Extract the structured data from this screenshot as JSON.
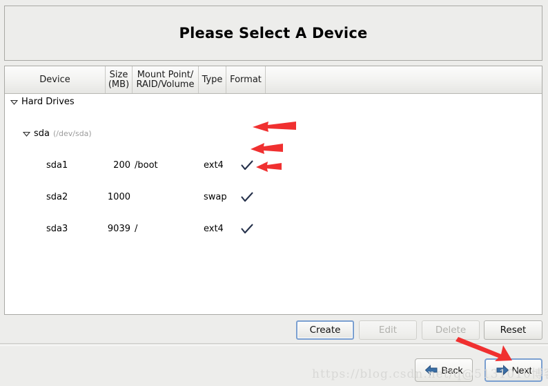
{
  "window": {
    "title": "Please Select A Device"
  },
  "colors": {
    "background": "#ededeb",
    "panel_border": "#a8a8a4",
    "table_background": "#ffffff",
    "focus_blue": "#7a9fd0",
    "checkmark": "#24304a",
    "annotation_red": "#f03030",
    "device_path": "#9b9b9b",
    "watermark": "#d8d8d6"
  },
  "table": {
    "columns": [
      {
        "label": "Device",
        "name": "column-device"
      },
      {
        "label": "Size\n(MB)",
        "name": "column-size"
      },
      {
        "label": "Mount Point/\nRAID/Volume",
        "name": "column-mount-point"
      },
      {
        "label": "Type",
        "name": "column-type"
      },
      {
        "label": "Format",
        "name": "column-format"
      }
    ],
    "rows": [
      {
        "kind": "group",
        "indent": 0,
        "expander": "chevron-down-icon",
        "device": "Hard Drives",
        "path": "",
        "size": "",
        "mount": "",
        "type": "",
        "format": false
      },
      {
        "kind": "drive",
        "indent": 1,
        "expander": "chevron-down-icon",
        "device": "sda",
        "path": "(/dev/sda)",
        "size": "",
        "mount": "",
        "type": "",
        "format": false
      },
      {
        "kind": "partition",
        "indent": 2,
        "expander": "",
        "device": "sda1",
        "path": "",
        "size": "200",
        "mount": "/boot",
        "type": "ext4",
        "format": true
      },
      {
        "kind": "partition",
        "indent": 2,
        "expander": "",
        "device": "sda2",
        "path": "",
        "size": "1000",
        "mount": "",
        "type": "swap",
        "format": true
      },
      {
        "kind": "partition",
        "indent": 2,
        "expander": "",
        "device": "sda3",
        "path": "",
        "size": "9039",
        "mount": "/",
        "type": "ext4",
        "format": true
      }
    ]
  },
  "action_bar": {
    "create": {
      "label": "Create",
      "enabled": true,
      "focused": true
    },
    "edit": {
      "label": "Edit",
      "enabled": false,
      "focused": false
    },
    "delete": {
      "label": "Delete",
      "enabled": false,
      "focused": false
    },
    "reset": {
      "label": "Reset",
      "enabled": true,
      "focused": false
    }
  },
  "nav_bar": {
    "back": {
      "label": "Back",
      "icon": "arrow-left-icon",
      "focused": false
    },
    "next": {
      "label": "Next",
      "icon": "arrow-right-icon",
      "focused": true
    }
  },
  "watermark": {
    "text": "https://blog.csdn.net/q@5131010博客"
  },
  "annotations": {
    "count": 4,
    "description": "red arrows pointing at format checkmarks and the Next button"
  }
}
